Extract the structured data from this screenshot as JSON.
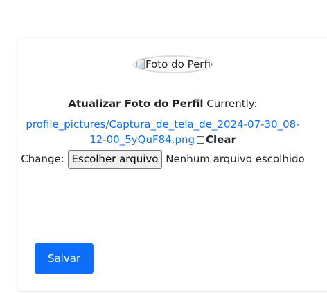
{
  "profile": {
    "photo_alt": "Foto do Perfil"
  },
  "form": {
    "field_label": "Atualizar Foto do Perfil",
    "currently_label": "Currently:",
    "current_file_line1": "profile_pictures/Captura_de_tela_de_2024-07-30_08-",
    "current_file_line2": "12-00_5yQuF84.png",
    "clear_label": "Clear",
    "change_label": "Change:",
    "choose_file_button": "Escolher arquivo",
    "no_file_text": "Nenhum arquivo escolhido"
  },
  "actions": {
    "save_label": "Salvar"
  },
  "colors": {
    "primary": "#0d6efd",
    "link": "#0d6efd"
  }
}
